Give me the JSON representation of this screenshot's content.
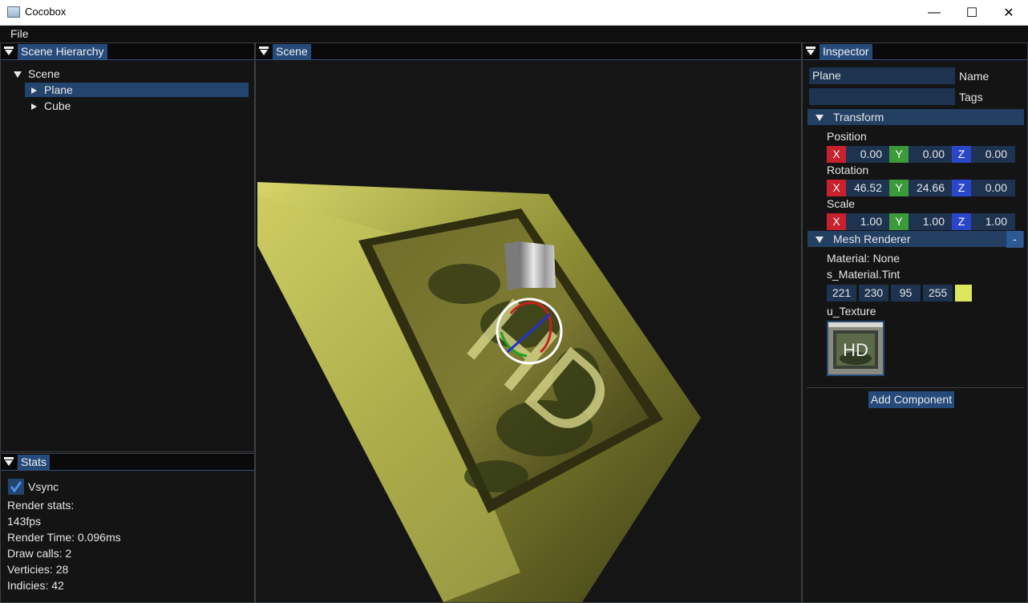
{
  "window": {
    "title": "Cocobox",
    "minimize": "—",
    "maximize": "☐",
    "close": "✕"
  },
  "menu": {
    "file": "File"
  },
  "hierarchy": {
    "tab": "Scene Hierarchy",
    "root": "Scene",
    "items": [
      {
        "label": "Plane",
        "selected": true
      },
      {
        "label": "Cube",
        "selected": false
      }
    ]
  },
  "stats": {
    "tab": "Stats",
    "vsync_label": "Vsync",
    "vsync_checked": true,
    "lines": [
      "Render stats:",
      "143fps",
      "Render Time: 0.096ms",
      "Draw calls: 2",
      "Verticies: 28",
      "Indicies: 42"
    ]
  },
  "scene": {
    "tab": "Scene",
    "texture_text": "HD"
  },
  "inspector": {
    "tab": "Inspector",
    "name_value": "Plane",
    "name_label": "Name",
    "tags_value": "",
    "tags_label": "Tags",
    "transform": {
      "title": "Transform",
      "position_label": "Position",
      "position": [
        "0.00",
        "0.00",
        "0.00"
      ],
      "rotation_label": "Rotation",
      "rotation": [
        "46.52",
        "24.66",
        "0.00"
      ],
      "scale_label": "Scale",
      "scale": [
        "1.00",
        "1.00",
        "1.00"
      ],
      "axes": [
        "X",
        "Y",
        "Z"
      ]
    },
    "mesh_renderer": {
      "title": "Mesh Renderer",
      "remove": "-",
      "material": "Material: None",
      "tint_label": "s_Material.Tint",
      "tint": [
        "221",
        "230",
        "95",
        "255"
      ],
      "tint_color": "#dde65f",
      "texture_label": "u_Texture",
      "texture_text": "HD"
    },
    "add_component": "Add Component"
  },
  "colors": {
    "accent": "#264b7a",
    "axis_x": "#c8202c",
    "axis_y": "#3b9a3a",
    "axis_z": "#2a47c9"
  }
}
